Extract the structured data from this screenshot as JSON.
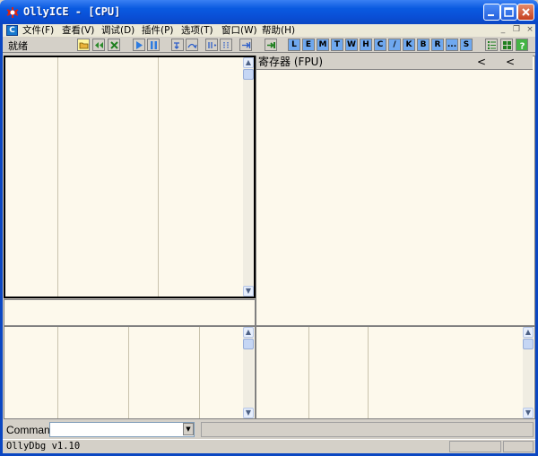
{
  "window": {
    "title": "OllyICE - [CPU]",
    "minimize_glyph": "–",
    "restore_glyph": "❐",
    "close_glyph": "✕"
  },
  "menu": {
    "doc_icon_letter": "C",
    "items": [
      {
        "label": "文件(F)"
      },
      {
        "label": "查看(V)"
      },
      {
        "label": "调试(D)"
      },
      {
        "label": "插件(P)"
      },
      {
        "label": "选项(T)"
      },
      {
        "label": "窗口(W)"
      },
      {
        "label": "帮助(H)"
      }
    ],
    "mdi_minimize": "_",
    "mdi_restore": "❐",
    "mdi_close": "×"
  },
  "toolbar": {
    "status": "就绪",
    "letter_buttons": [
      "L",
      "E",
      "M",
      "T",
      "W",
      "H",
      "C",
      "/",
      "K",
      "B",
      "R",
      "...",
      "S"
    ]
  },
  "registers": {
    "header": "寄存器 (FPU)",
    "nav_left": "<",
    "nav_right": "<"
  },
  "scroll": {
    "up": "▲",
    "down": "▼"
  },
  "command": {
    "label": "Command",
    "value": "",
    "dropdown_glyph": "▼"
  },
  "status": {
    "text": "OllyDbg v1.10"
  },
  "colors": {
    "pane_bg": "#fdf9ec",
    "titlebar": "#0a5ae0",
    "chrome": "#d4d0c8"
  }
}
